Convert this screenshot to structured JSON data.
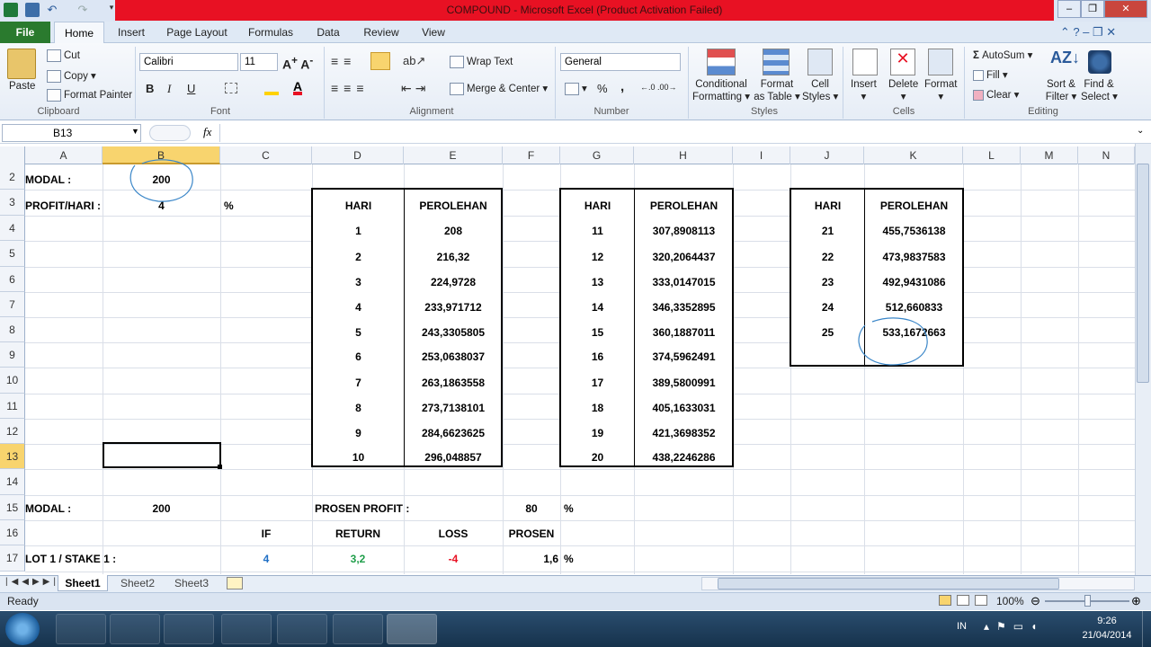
{
  "window": {
    "title": "COMPOUND  -  Microsoft Excel (Product Activation Failed)"
  },
  "ribbon_tabs": [
    "File",
    "Home",
    "Insert",
    "Page Layout",
    "Formulas",
    "Data",
    "Review",
    "View"
  ],
  "clipboard": {
    "paste": "Paste",
    "cut": "Cut",
    "copy": "Copy",
    "format_painter": "Format Painter",
    "group": "Clipboard"
  },
  "font": {
    "name": "Calibri",
    "size": "11",
    "bold": "B",
    "italic": "I",
    "underline": "U",
    "group": "Font"
  },
  "alignment": {
    "wrap": "Wrap Text",
    "merge": "Merge & Center",
    "group": "Alignment"
  },
  "number": {
    "format": "General",
    "percent": "%",
    "comma": ",",
    "group": "Number"
  },
  "styles": {
    "conditional": "Conditional",
    "conditional2": "Formatting",
    "format_table": "Format",
    "format_table2": "as Table",
    "cell_styles": "Cell",
    "cell_styles2": "Styles",
    "group": "Styles"
  },
  "cells": {
    "insert": "Insert",
    "delete": "Delete",
    "format": "Format",
    "group": "Cells"
  },
  "editing": {
    "autosum": "AutoSum",
    "fill": "Fill",
    "clear": "Clear",
    "sort": "Sort &",
    "sort2": "Filter",
    "find": "Find &",
    "find2": "Select",
    "group": "Editing"
  },
  "formula_bar": {
    "name_box": "B13",
    "fx": "fx",
    "value": ""
  },
  "columns": [
    "A",
    "B",
    "C",
    "D",
    "E",
    "F",
    "G",
    "H",
    "I",
    "J",
    "K",
    "L",
    "M",
    "N"
  ],
  "rows": [
    "2",
    "3",
    "4",
    "5",
    "6",
    "7",
    "8",
    "9",
    "10",
    "11",
    "12",
    "13",
    "14",
    "15",
    "16",
    "17"
  ],
  "cells_data": {
    "modal_label": "MODAL       :",
    "modal_value": "200",
    "profit_label": "PROFIT/HARI :",
    "profit_value": "4",
    "profit_unit": "%",
    "modal2_label": "MODAL :",
    "modal2_value": "200",
    "prosen_profit_label": "PROSEN PROFIT :",
    "prosen_profit_value": "80",
    "prosen_profit_unit": "%",
    "if_label": "IF",
    "return_label": "RETURN",
    "loss_label": "LOSS",
    "prosen_label": "PROSEN",
    "lot_label": "LOT 1  / STAKE 1  :",
    "lot_if": "4",
    "lot_return": "3,2",
    "lot_loss": "-4",
    "lot_prosen": "1,6",
    "lot_unit": "%"
  },
  "table1": {
    "h1": "HARI",
    "h2": "PEROLEHAN",
    "rows": [
      [
        "1",
        "208"
      ],
      [
        "2",
        "216,32"
      ],
      [
        "3",
        "224,9728"
      ],
      [
        "4",
        "233,971712"
      ],
      [
        "5",
        "243,3305805"
      ],
      [
        "6",
        "253,0638037"
      ],
      [
        "7",
        "263,1863558"
      ],
      [
        "8",
        "273,7138101"
      ],
      [
        "9",
        "284,6623625"
      ],
      [
        "10",
        "296,048857"
      ]
    ]
  },
  "table2": {
    "h1": "HARI",
    "h2": "PEROLEHAN",
    "rows": [
      [
        "11",
        "307,8908113"
      ],
      [
        "12",
        "320,2064437"
      ],
      [
        "13",
        "333,0147015"
      ],
      [
        "14",
        "346,3352895"
      ],
      [
        "15",
        "360,1887011"
      ],
      [
        "16",
        "374,5962491"
      ],
      [
        "17",
        "389,5800991"
      ],
      [
        "18",
        "405,1633031"
      ],
      [
        "19",
        "421,3698352"
      ],
      [
        "20",
        "438,2246286"
      ]
    ]
  },
  "table3": {
    "h1": "HARI",
    "h2": "PEROLEHAN",
    "rows": [
      [
        "21",
        "455,7536138"
      ],
      [
        "22",
        "473,9837583"
      ],
      [
        "23",
        "492,9431086"
      ],
      [
        "24",
        "512,660833"
      ],
      [
        "25",
        "533,1672663"
      ]
    ]
  },
  "sheets": [
    "Sheet1",
    "Sheet2",
    "Sheet3"
  ],
  "status": {
    "ready": "Ready",
    "zoom": "100%"
  },
  "tray": {
    "lang": "IN",
    "time": "9:26",
    "date": "21/04/2014"
  },
  "colors": {
    "title_red": "#e81123",
    "file_green": "#2a7a2e",
    "blue_value": "#1f6fc5",
    "green_value": "#1f9e4a",
    "red_value": "#e81123",
    "annotation": "#3a86c8"
  }
}
